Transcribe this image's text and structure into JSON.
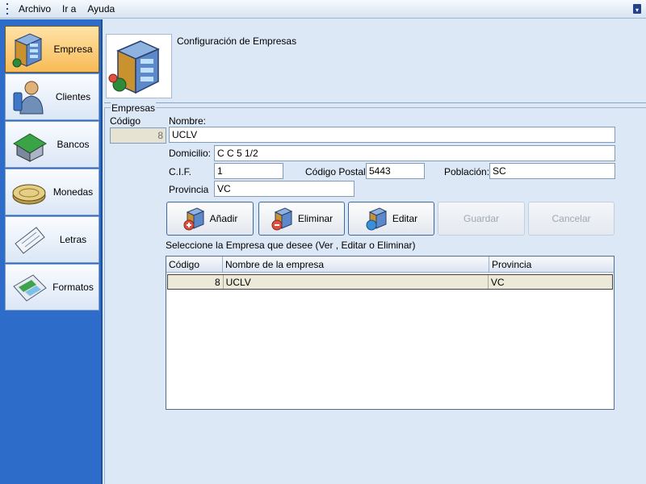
{
  "menu": {
    "items": [
      "Archivo",
      "Ir a",
      "Ayuda"
    ]
  },
  "sidebar": {
    "items": [
      {
        "label": "Empresa",
        "icon": "building-icon",
        "active": true
      },
      {
        "label": "Clientes",
        "icon": "person-icon",
        "active": false
      },
      {
        "label": "Bancos",
        "icon": "bank-house-icon",
        "active": false
      },
      {
        "label": "Monedas",
        "icon": "coins-icon",
        "active": false
      },
      {
        "label": "Letras",
        "icon": "letter-document-icon",
        "active": false
      },
      {
        "label": "Formatos",
        "icon": "spreadsheet-icon",
        "active": false
      }
    ]
  },
  "header": {
    "title": "Configuración de Empresas"
  },
  "group": {
    "title": "Empresas"
  },
  "form": {
    "codigo_label": "Código",
    "codigo_value": "8",
    "nombre_label": "Nombre:",
    "nombre_value": "UCLV",
    "domicilio_label": "Domicilio:",
    "domicilio_value": "C C 5 1/2",
    "cif_label": "C.I.F.",
    "cif_value": "1",
    "codigo_postal_label": "Código Postal:",
    "codigo_postal_value": "5443",
    "poblacion_label": "Población:",
    "poblacion_value": "SC",
    "provincia_label": "Provincia",
    "provincia_value": "VC"
  },
  "buttons": {
    "anadir": "Añadir",
    "eliminar": "Eliminar",
    "editar": "Editar",
    "guardar": "Guardar",
    "cancelar": "Cancelar"
  },
  "list": {
    "caption": "Seleccione la Empresa que desee (Ver , Editar o Eliminar)",
    "columns": [
      "Código",
      "Nombre de la empresa",
      "Provincia"
    ],
    "rows": [
      {
        "codigo": "8",
        "nombre": "UCLV",
        "provincia": "VC"
      }
    ]
  },
  "colors": {
    "sidebar_bg": "#2d6cc8",
    "active_item": "#f7bb56",
    "panel_bg": "#dce8f6"
  }
}
